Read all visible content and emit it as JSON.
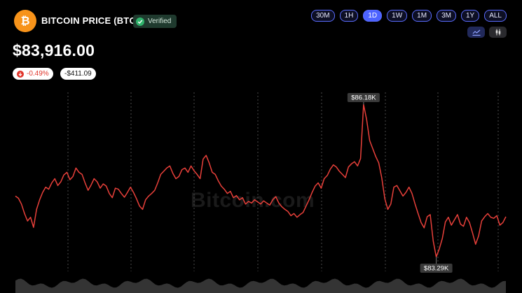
{
  "header": {
    "title": "BITCOIN PRICE (BTC)",
    "verified_label": "Verified",
    "price": "$83,916.00",
    "change_pct": "-0.49%",
    "change_abs": "-$411.09"
  },
  "timeframes": [
    {
      "label": "30M",
      "active": false
    },
    {
      "label": "1H",
      "active": false
    },
    {
      "label": "1D",
      "active": true
    },
    {
      "label": "1W",
      "active": false
    },
    {
      "label": "1M",
      "active": false
    },
    {
      "label": "3M",
      "active": false
    },
    {
      "label": "1Y",
      "active": false
    },
    {
      "label": "ALL",
      "active": false
    }
  ],
  "chart_types": [
    {
      "icon": "line-chart-icon",
      "active": true
    },
    {
      "icon": "candlestick-icon",
      "active": false
    }
  ],
  "watermark": "Bitcoin.com",
  "colors": {
    "accent": "#4c63ff",
    "line": "#e8403a",
    "bitcoin": "#f7931a",
    "verified": "#2fb36b"
  },
  "chart_data": {
    "type": "line",
    "ylim": [
      83200,
      86280
    ],
    "high_label": "$86.18K",
    "low_label": "$83.29K",
    "values": [
      84450,
      84410,
      84300,
      84120,
      83980,
      84050,
      83860,
      84200,
      84380,
      84520,
      84620,
      84580,
      84700,
      84780,
      84650,
      84720,
      84850,
      84900,
      84760,
      84820,
      84980,
      84900,
      84860,
      84700,
      84560,
      84660,
      84780,
      84720,
      84600,
      84680,
      84640,
      84500,
      84420,
      84600,
      84580,
      84500,
      84430,
      84520,
      84620,
      84520,
      84400,
      84260,
      84200,
      84380,
      84450,
      84500,
      84560,
      84700,
      84860,
      84920,
      84980,
      85020,
      84880,
      84780,
      84820,
      84950,
      84980,
      84900,
      85020,
      84930,
      84860,
      84780,
      85150,
      85220,
      85080,
      84900,
      84860,
      84740,
      84640,
      84580,
      84500,
      84540,
      84420,
      84460,
      84380,
      84420,
      84300,
      84350,
      84320,
      84380,
      84340,
      84300,
      84360,
      84320,
      84280,
      84380,
      84440,
      84320,
      84250,
      84200,
      84160,
      84080,
      84120,
      84050,
      84100,
      84140,
      84260,
      84380,
      84520,
      84640,
      84700,
      84600,
      84780,
      84840,
      84960,
      85040,
      85000,
      84920,
      84860,
      84800,
      85000,
      85060,
      85100,
      85020,
      85160,
      86180,
      85900,
      85500,
      85350,
      85200,
      85080,
      84800,
      84400,
      84200,
      84300,
      84620,
      84650,
      84550,
      84450,
      84520,
      84620,
      84500,
      84300,
      84120,
      83950,
      83850,
      84060,
      84100,
      83600,
      83300,
      83450,
      83650,
      83960,
      84050,
      83900,
      84000,
      84100,
      83920,
      83880,
      84050,
      83950,
      83750,
      83540,
      83700,
      83980,
      84060,
      84120,
      84050,
      84030,
      84080,
      83900,
      83950,
      84060
    ]
  }
}
